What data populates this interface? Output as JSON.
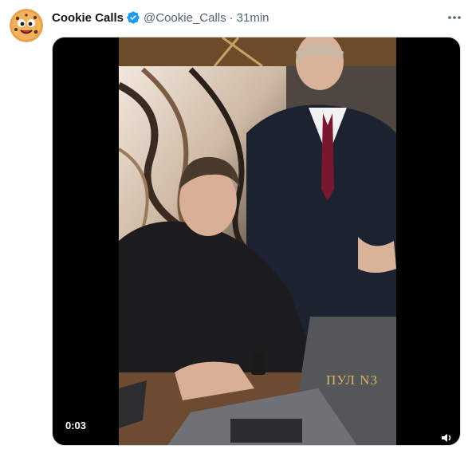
{
  "tweet": {
    "author_name": "Cookie Calls",
    "handle": "@Cookie_Calls",
    "separator": "·",
    "time": "31min",
    "verified": true
  },
  "media": {
    "duration": "0:03",
    "overlay_text": "ПУЛ N3"
  },
  "icons": {
    "avatar": "cookie-avatar",
    "verified": "verified-badge-icon",
    "more": "more-options-icon",
    "sound": "speaker-icon"
  },
  "colors": {
    "verified": "#1d9bf0",
    "text_primary": "#0f1419",
    "text_secondary": "#536471"
  }
}
